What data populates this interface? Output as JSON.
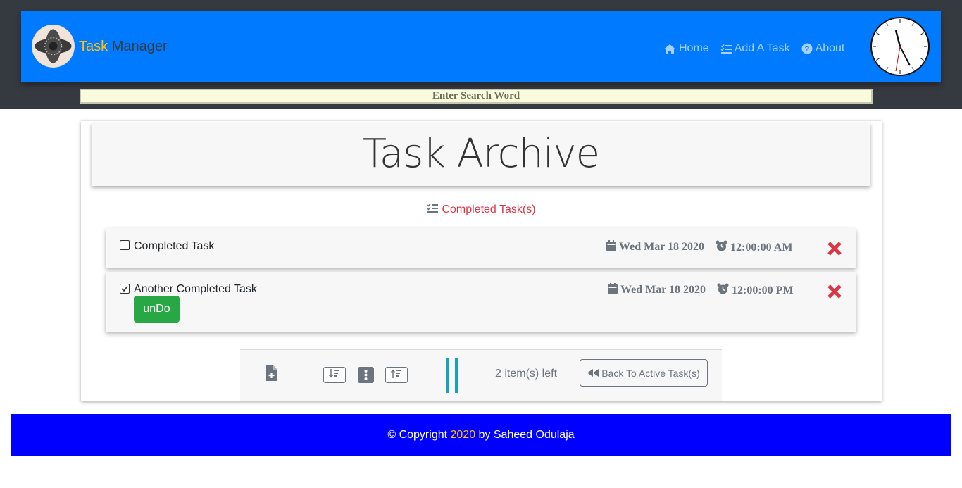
{
  "header": {
    "brand_part1": "Task",
    "brand_part2": "Manager",
    "nav": [
      {
        "label": "Home",
        "icon": "home-icon"
      },
      {
        "label": "Add A Task",
        "icon": "tasks-icon"
      },
      {
        "label": "About",
        "icon": "question-icon"
      }
    ]
  },
  "search": {
    "placeholder": "Enter Search Word"
  },
  "main": {
    "title": "Task Archive",
    "section_label": "Completed Task(s)",
    "tasks": [
      {
        "name": "Completed Task",
        "checked": false,
        "date": "Wed Mar 18 2020",
        "time": "12:00:00 AM"
      },
      {
        "name": "Another Completed Task",
        "checked": true,
        "date": "Wed Mar 18 2020",
        "time": "12:00:00 PM",
        "action": "unDo"
      }
    ]
  },
  "toolbar": {
    "items_left": "2 item(s) left",
    "back_label": "Back To Active Task(s)"
  },
  "footer": {
    "prefix": "© Copyright ",
    "year": "2020",
    "suffix": " by Saheed Odulaja"
  },
  "colors": {
    "navbar": "#007bff",
    "top_band": "#343a40",
    "brand_accent": "#ffc107",
    "danger": "#dc3545",
    "success": "#28a745",
    "footer": "#0000ff",
    "info": "#17a2b8"
  }
}
